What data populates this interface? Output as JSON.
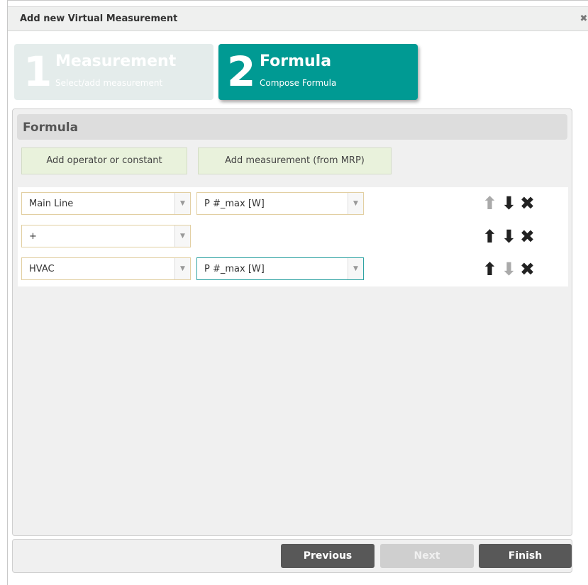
{
  "dialog": {
    "title": "Add new Virtual Measurement",
    "close_glyph": "✖"
  },
  "steps": [
    {
      "number": "1",
      "name": "Measurement",
      "subtitle": "Select/add measurement",
      "active": false
    },
    {
      "number": "2",
      "name": "Formula",
      "subtitle": "Compose Formula",
      "active": true
    }
  ],
  "panel": {
    "title": "Formula",
    "add_operator_label": "Add operator or constant",
    "add_measurement_label": "Add measurement (from MRP)"
  },
  "formula_rows": [
    {
      "first": "Main Line",
      "second": "P #_max [W]",
      "up_enabled": false,
      "down_enabled": true
    },
    {
      "first": "+",
      "second": null,
      "up_enabled": true,
      "down_enabled": true
    },
    {
      "first": "HVAC",
      "second": "P #_max [W]",
      "up_enabled": true,
      "down_enabled": false
    }
  ],
  "icons": {
    "up": "arrow-up-icon",
    "down": "arrow-down-icon",
    "remove": "close-icon",
    "dropdown": "chevron-down-icon"
  },
  "glyphs": {
    "up": "🡅",
    "down": "🡇",
    "remove": "✖",
    "dropdown": "▼"
  },
  "footer": {
    "previous_label": "Previous",
    "next_label": "Next",
    "finish_label": "Finish",
    "next_enabled": false
  },
  "colors": {
    "accent": "#009a93",
    "inactive_step": "#e4eceb",
    "add_button": "#e9f2dc",
    "dark_button": "#585858"
  }
}
